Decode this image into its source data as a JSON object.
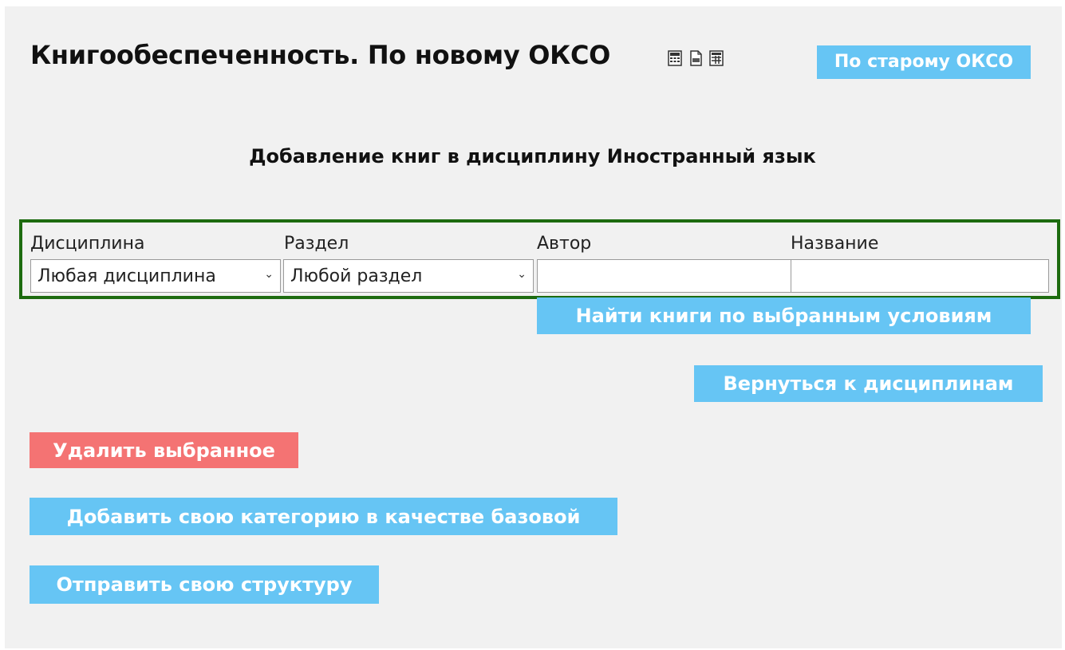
{
  "header": {
    "title": "Книгообеспеченность. По новому ОКСО",
    "icons": [
      "calculator-icon",
      "csv-file-icon",
      "spreadsheet-icon"
    ],
    "old_okso_button": "По старому ОКСО"
  },
  "subtitle": "Добавление книг в дисциплину Иностранный язык",
  "filters": {
    "discipline_label": "Дисциплина",
    "discipline_value": "Любая дисциплина",
    "section_label": "Раздел",
    "section_value": "Любой раздел",
    "author_label": "Автор",
    "author_value": "",
    "name_label": "Название",
    "name_value": ""
  },
  "actions": {
    "find_button": "Найти книги по выбранным условиям",
    "back_button": "Вернуться к дисциплинам",
    "delete_button": "Удалить выбранное",
    "add_category_button": "Добавить свою категорию в качестве базовой",
    "send_structure_button": "Отправить свою структуру"
  },
  "colors": {
    "button": "#66c5f4",
    "danger": "#f47373",
    "filter_border": "#1d6b0f",
    "background": "#f1f1f1"
  }
}
